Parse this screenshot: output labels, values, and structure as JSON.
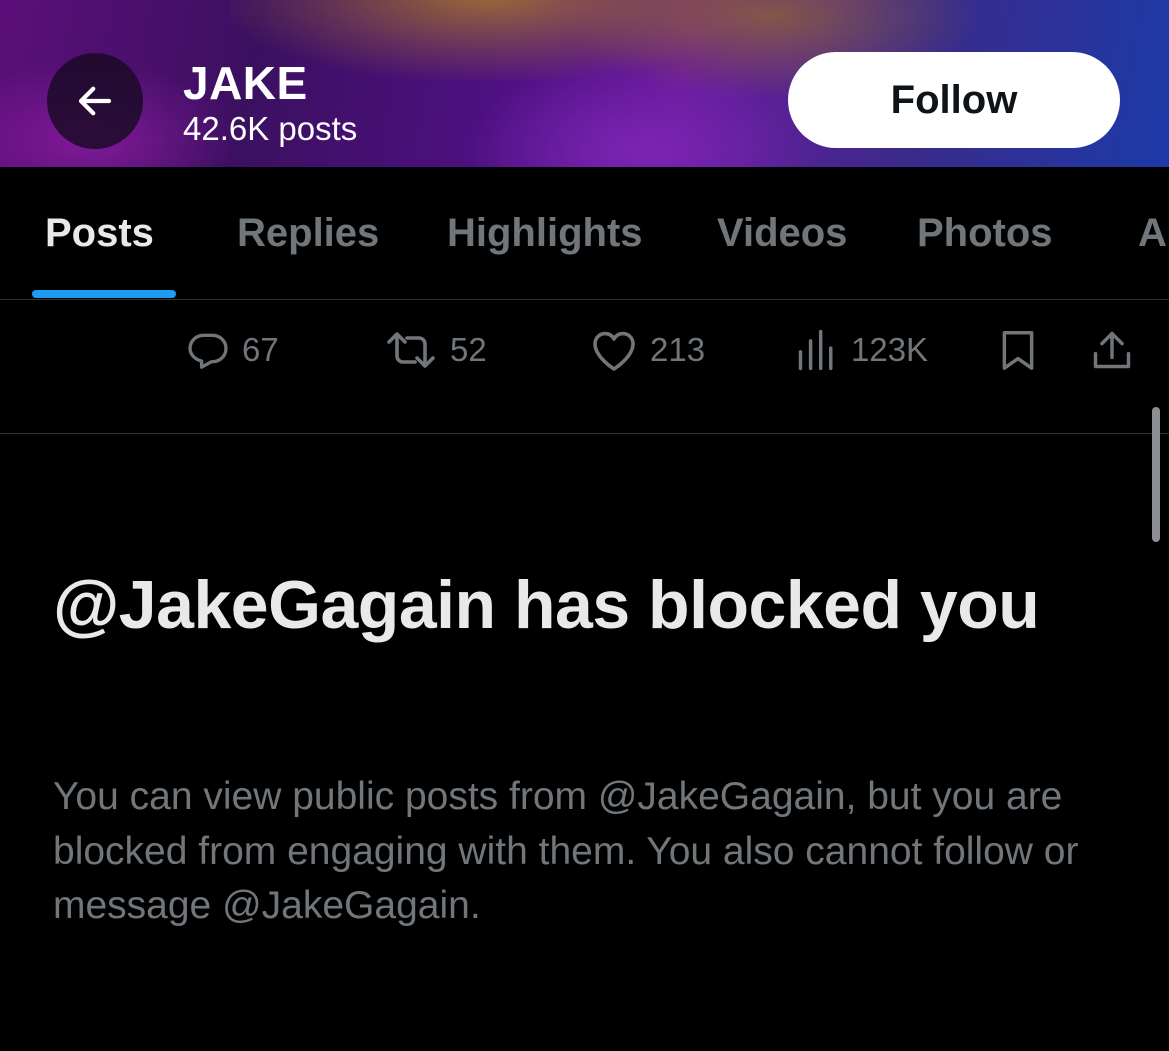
{
  "header": {
    "back_icon": "arrow-left-icon",
    "name": "JAKE",
    "post_count": "42.6K posts",
    "follow_label": "Follow"
  },
  "tabs": [
    {
      "label": "Posts",
      "active": true
    },
    {
      "label": "Replies",
      "active": false
    },
    {
      "label": "Highlights",
      "active": false
    },
    {
      "label": "Videos",
      "active": false
    },
    {
      "label": "Photos",
      "active": false
    },
    {
      "label": "A",
      "active": false
    }
  ],
  "post_actions": {
    "replies": {
      "icon": "reply-icon",
      "count": "67"
    },
    "reposts": {
      "icon": "repost-icon",
      "count": "52"
    },
    "likes": {
      "icon": "heart-icon",
      "count": "213"
    },
    "views": {
      "icon": "analytics-icon",
      "count": "123K"
    },
    "bookmark": {
      "icon": "bookmark-icon"
    },
    "share": {
      "icon": "share-icon"
    }
  },
  "blocked": {
    "title": "@JakeGagain has blocked you",
    "description": "You can view public posts from @JakeGagain, but you are blocked from engaging with them. You also cannot follow or message @JakeGagain."
  },
  "colors": {
    "background": "#000000",
    "text_primary": "#e7e9ea",
    "text_secondary": "#71767b",
    "accent": "#1d9bf0",
    "follow_bg": "#ffffff",
    "divider": "#2f3336"
  }
}
